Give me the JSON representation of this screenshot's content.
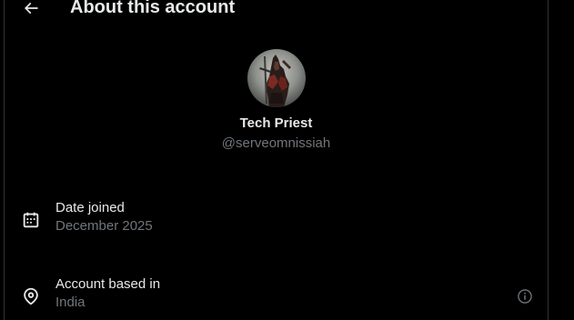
{
  "header": {
    "title": "About this account",
    "back_icon": "arrow-left-icon"
  },
  "profile": {
    "display_name": "Tech Priest",
    "username": "@serveomnissiah",
    "avatar_icon": "avatar"
  },
  "details": {
    "date_joined": {
      "icon": "calendar-icon",
      "label": "Date joined",
      "value": "December 2025"
    },
    "based_in": {
      "icon": "location-pin-icon",
      "label": "Account based in",
      "value": "India",
      "info_icon": "info-icon"
    }
  },
  "colors": {
    "background": "#000000",
    "primary_text": "#e7e9ea",
    "secondary_text": "#71767b",
    "border": "#2f3336"
  }
}
